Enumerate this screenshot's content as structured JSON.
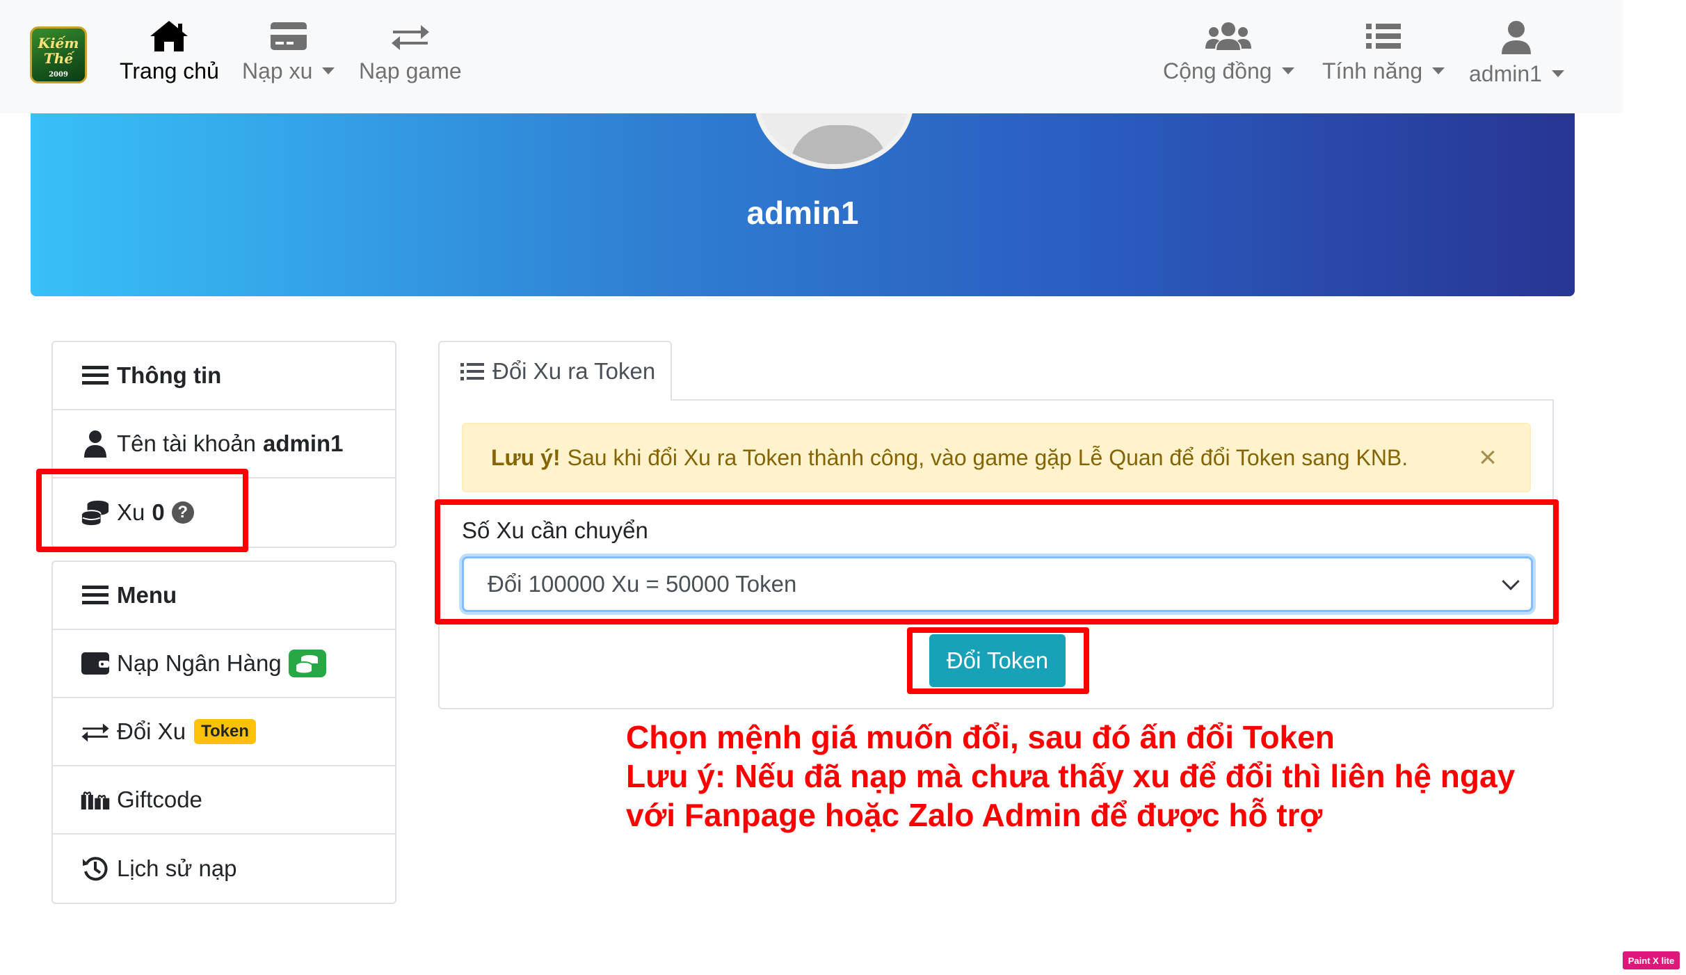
{
  "navbar": {
    "logo": {
      "text": "Kiếm Thế",
      "year": "2009"
    },
    "left_items": [
      {
        "label": "Trang chủ",
        "icon": "home-icon",
        "active": true
      },
      {
        "label": "Nạp xu",
        "icon": "credit-card-icon",
        "dropdown": true
      },
      {
        "label": "Nạp game",
        "icon": "exchange-icon"
      }
    ],
    "right_items": [
      {
        "label": "Cộng đồng",
        "icon": "users-icon",
        "dropdown": true
      },
      {
        "label": "Tính năng",
        "icon": "list-icon",
        "dropdown": true
      },
      {
        "label": "admin1",
        "icon": "user-icon",
        "dropdown": true
      }
    ]
  },
  "banner": {
    "username": "admin1"
  },
  "info_card": {
    "title": "Thông tin",
    "account_label": "Tên tài khoản",
    "account_value": "admin1",
    "xu_label": "Xu",
    "xu_value": "0",
    "help_icon": "?"
  },
  "menu_card": {
    "title": "Menu",
    "items": [
      {
        "label": "Nạp Ngân Hàng",
        "icon": "wallet-icon"
      },
      {
        "label": "Đổi Xu",
        "badge": "Token",
        "icon": "exchange-icon"
      },
      {
        "label": "Giftcode",
        "icon": "gifts-icon"
      },
      {
        "label": "Lịch sử nạp",
        "icon": "history-icon"
      }
    ]
  },
  "tab": {
    "label": "Đổi Xu ra Token"
  },
  "alert": {
    "strong": "Lưu ý!",
    "text": "Sau khi đổi Xu ra Token thành công, vào game gặp Lễ Quan để đổi Token sang KNB.",
    "close": "×"
  },
  "form": {
    "label": "Số Xu cần chuyển",
    "selected": "Đổi 100000 Xu = 50000 Token",
    "submit": "Đổi Token"
  },
  "annotation": {
    "lines": [
      "Chọn mệnh giá muốn đổi, sau đó ấn đổi Token",
      "Lưu ý: Nếu đã nạp mà chưa thấy xu để đổi thì liên hệ ngay",
      "với Fanpage hoặc Zalo Admin để được hỗ trợ"
    ]
  },
  "colors": {
    "accent": "#17a2b8",
    "annotation_red": "#ff0000",
    "alert_bg": "#fff3cd",
    "banner_start": "#38c0f8",
    "banner_end": "#283593"
  },
  "watermark": "Paint X lite"
}
